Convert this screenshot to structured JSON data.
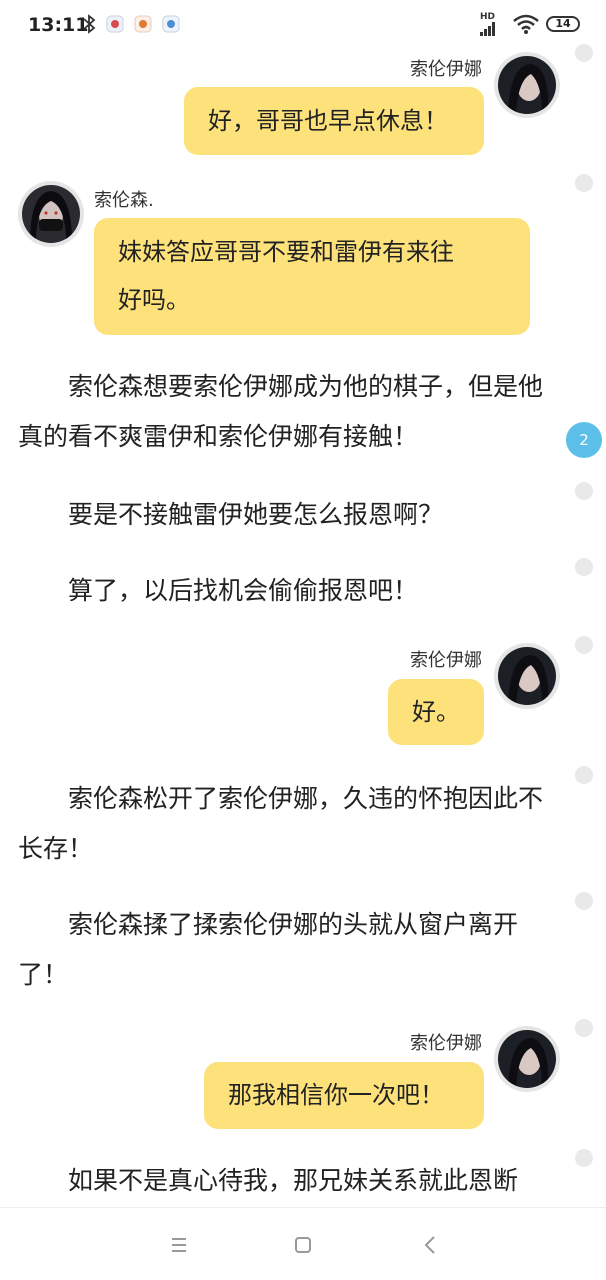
{
  "status_bar": {
    "time": "13:11",
    "hd_label": "HD",
    "battery": "14"
  },
  "messages": [
    {
      "speaker": "索伦伊娜",
      "text": "好，哥哥也早点休息！"
    },
    {
      "speaker": "索伦森.",
      "line1": "妹妹答应哥哥不要和雷伊有来往",
      "line2": "好吗。"
    },
    {
      "speaker": "索伦伊娜",
      "text": "好。"
    },
    {
      "speaker": "索伦伊娜",
      "text": "那我相信你一次吧！"
    }
  ],
  "narration": [
    "索伦森想要索伦伊娜成为他的棋子，但是他真的看不爽雷伊和索伦伊娜有接触！",
    "要是不接触雷伊她要怎么报恩啊？",
    "算了，以后找机会偷偷报恩吧！",
    "索伦森松开了索伦伊娜，久违的怀抱因此不长存！",
    "索伦森揉了揉索伦伊娜的头就从窗户离开了！",
    "如果不是真心待我，那兄妹关系就此恩断"
  ],
  "side_badge": "2"
}
